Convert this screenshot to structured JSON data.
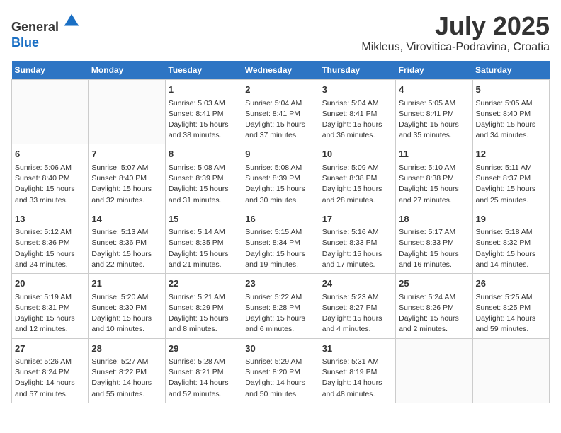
{
  "header": {
    "logo_line1": "General",
    "logo_line2": "Blue",
    "month_year": "July 2025",
    "location": "Mikleus, Virovitica-Podravina, Croatia"
  },
  "days_of_week": [
    "Sunday",
    "Monday",
    "Tuesday",
    "Wednesday",
    "Thursday",
    "Friday",
    "Saturday"
  ],
  "weeks": [
    [
      {
        "day": "",
        "info": ""
      },
      {
        "day": "",
        "info": ""
      },
      {
        "day": "1",
        "info": "Sunrise: 5:03 AM\nSunset: 8:41 PM\nDaylight: 15 hours and 38 minutes."
      },
      {
        "day": "2",
        "info": "Sunrise: 5:04 AM\nSunset: 8:41 PM\nDaylight: 15 hours and 37 minutes."
      },
      {
        "day": "3",
        "info": "Sunrise: 5:04 AM\nSunset: 8:41 PM\nDaylight: 15 hours and 36 minutes."
      },
      {
        "day": "4",
        "info": "Sunrise: 5:05 AM\nSunset: 8:41 PM\nDaylight: 15 hours and 35 minutes."
      },
      {
        "day": "5",
        "info": "Sunrise: 5:05 AM\nSunset: 8:40 PM\nDaylight: 15 hours and 34 minutes."
      }
    ],
    [
      {
        "day": "6",
        "info": "Sunrise: 5:06 AM\nSunset: 8:40 PM\nDaylight: 15 hours and 33 minutes."
      },
      {
        "day": "7",
        "info": "Sunrise: 5:07 AM\nSunset: 8:40 PM\nDaylight: 15 hours and 32 minutes."
      },
      {
        "day": "8",
        "info": "Sunrise: 5:08 AM\nSunset: 8:39 PM\nDaylight: 15 hours and 31 minutes."
      },
      {
        "day": "9",
        "info": "Sunrise: 5:08 AM\nSunset: 8:39 PM\nDaylight: 15 hours and 30 minutes."
      },
      {
        "day": "10",
        "info": "Sunrise: 5:09 AM\nSunset: 8:38 PM\nDaylight: 15 hours and 28 minutes."
      },
      {
        "day": "11",
        "info": "Sunrise: 5:10 AM\nSunset: 8:38 PM\nDaylight: 15 hours and 27 minutes."
      },
      {
        "day": "12",
        "info": "Sunrise: 5:11 AM\nSunset: 8:37 PM\nDaylight: 15 hours and 25 minutes."
      }
    ],
    [
      {
        "day": "13",
        "info": "Sunrise: 5:12 AM\nSunset: 8:36 PM\nDaylight: 15 hours and 24 minutes."
      },
      {
        "day": "14",
        "info": "Sunrise: 5:13 AM\nSunset: 8:36 PM\nDaylight: 15 hours and 22 minutes."
      },
      {
        "day": "15",
        "info": "Sunrise: 5:14 AM\nSunset: 8:35 PM\nDaylight: 15 hours and 21 minutes."
      },
      {
        "day": "16",
        "info": "Sunrise: 5:15 AM\nSunset: 8:34 PM\nDaylight: 15 hours and 19 minutes."
      },
      {
        "day": "17",
        "info": "Sunrise: 5:16 AM\nSunset: 8:33 PM\nDaylight: 15 hours and 17 minutes."
      },
      {
        "day": "18",
        "info": "Sunrise: 5:17 AM\nSunset: 8:33 PM\nDaylight: 15 hours and 16 minutes."
      },
      {
        "day": "19",
        "info": "Sunrise: 5:18 AM\nSunset: 8:32 PM\nDaylight: 15 hours and 14 minutes."
      }
    ],
    [
      {
        "day": "20",
        "info": "Sunrise: 5:19 AM\nSunset: 8:31 PM\nDaylight: 15 hours and 12 minutes."
      },
      {
        "day": "21",
        "info": "Sunrise: 5:20 AM\nSunset: 8:30 PM\nDaylight: 15 hours and 10 minutes."
      },
      {
        "day": "22",
        "info": "Sunrise: 5:21 AM\nSunset: 8:29 PM\nDaylight: 15 hours and 8 minutes."
      },
      {
        "day": "23",
        "info": "Sunrise: 5:22 AM\nSunset: 8:28 PM\nDaylight: 15 hours and 6 minutes."
      },
      {
        "day": "24",
        "info": "Sunrise: 5:23 AM\nSunset: 8:27 PM\nDaylight: 15 hours and 4 minutes."
      },
      {
        "day": "25",
        "info": "Sunrise: 5:24 AM\nSunset: 8:26 PM\nDaylight: 15 hours and 2 minutes."
      },
      {
        "day": "26",
        "info": "Sunrise: 5:25 AM\nSunset: 8:25 PM\nDaylight: 14 hours and 59 minutes."
      }
    ],
    [
      {
        "day": "27",
        "info": "Sunrise: 5:26 AM\nSunset: 8:24 PM\nDaylight: 14 hours and 57 minutes."
      },
      {
        "day": "28",
        "info": "Sunrise: 5:27 AM\nSunset: 8:22 PM\nDaylight: 14 hours and 55 minutes."
      },
      {
        "day": "29",
        "info": "Sunrise: 5:28 AM\nSunset: 8:21 PM\nDaylight: 14 hours and 52 minutes."
      },
      {
        "day": "30",
        "info": "Sunrise: 5:29 AM\nSunset: 8:20 PM\nDaylight: 14 hours and 50 minutes."
      },
      {
        "day": "31",
        "info": "Sunrise: 5:31 AM\nSunset: 8:19 PM\nDaylight: 14 hours and 48 minutes."
      },
      {
        "day": "",
        "info": ""
      },
      {
        "day": "",
        "info": ""
      }
    ]
  ]
}
